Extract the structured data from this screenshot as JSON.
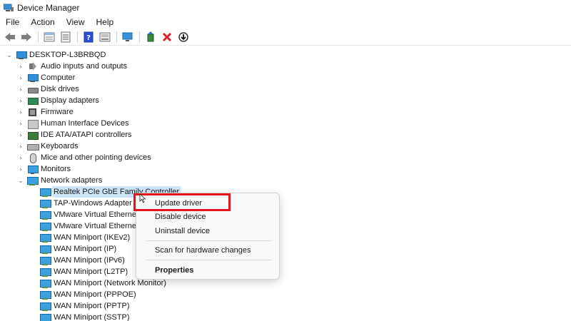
{
  "window": {
    "title": "Device Manager",
    "icon": "device-manager-icon"
  },
  "menu": [
    "File",
    "Action",
    "View",
    "Help"
  ],
  "toolbar": {
    "buttons": [
      "back-arrow-icon",
      "forward-arrow-icon",
      "properties-icon",
      "show-hide-icon",
      "help-icon",
      "print-icon",
      "scan-hardware-icon",
      "update-driver-icon",
      "uninstall-icon",
      "disable-icon"
    ],
    "colors": {
      "uninstall": "#d8232a",
      "help": "#2b4fd8"
    }
  },
  "tree": {
    "root": "DESKTOP-L3BRBQD",
    "categories": [
      {
        "label": "Audio inputs and outputs",
        "icon": "speaker-icon"
      },
      {
        "label": "Computer",
        "icon": "computer-icon"
      },
      {
        "label": "Disk drives",
        "icon": "disk-drive-icon"
      },
      {
        "label": "Display adapters",
        "icon": "display-adapter-icon"
      },
      {
        "label": "Firmware",
        "icon": "firmware-icon"
      },
      {
        "label": "Human Interface Devices",
        "icon": "hid-icon"
      },
      {
        "label": "IDE ATA/ATAPI controllers",
        "icon": "ide-controller-icon"
      },
      {
        "label": "Keyboards",
        "icon": "keyboard-icon"
      },
      {
        "label": "Mice and other pointing devices",
        "icon": "mouse-icon"
      },
      {
        "label": "Monitors",
        "icon": "monitor-icon"
      },
      {
        "label": "Network adapters",
        "icon": "network-adapter-icon"
      }
    ],
    "network_children": [
      "Realtek PCIe GbE Family Controller",
      "TAP-Windows Adapter V",
      "VMware Virtual Ethernet",
      "VMware Virtual Etherne",
      "WAN Miniport (IKEv2)",
      "WAN Miniport (IP)",
      "WAN Miniport (IPv6)",
      "WAN Miniport (L2TP)",
      "WAN Miniport (Network Monitor)",
      "WAN Miniport (PPPOE)",
      "WAN Miniport (PPTP)",
      "WAN Miniport (SSTP)"
    ],
    "selected_color": "#cce4f7"
  },
  "context_menu": {
    "items": [
      "Update driver",
      "Disable device",
      "Uninstall device",
      "Scan for hardware changes",
      "Properties"
    ],
    "highlight_color": "#e0161f"
  }
}
